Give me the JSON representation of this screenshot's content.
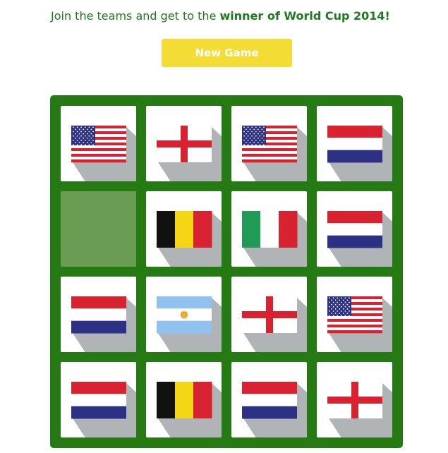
{
  "intro": {
    "text": "Join the teams and get to the ",
    "highlight": "winner of World Cup 2014!"
  },
  "button": {
    "label": "New Game"
  },
  "colors": {
    "board": "#267a13",
    "accent": "#f3dd35",
    "text": "#1d7a1d",
    "empty_tile": "#6b9c53"
  },
  "board": {
    "rows": 4,
    "cols": 4,
    "tiles": [
      "usa",
      "england",
      "usa",
      "netherlands",
      "empty",
      "belgium",
      "italy",
      "netherlands",
      "netherlands",
      "argentina",
      "england",
      "usa",
      "netherlands",
      "belgium",
      "netherlands",
      "england"
    ]
  }
}
